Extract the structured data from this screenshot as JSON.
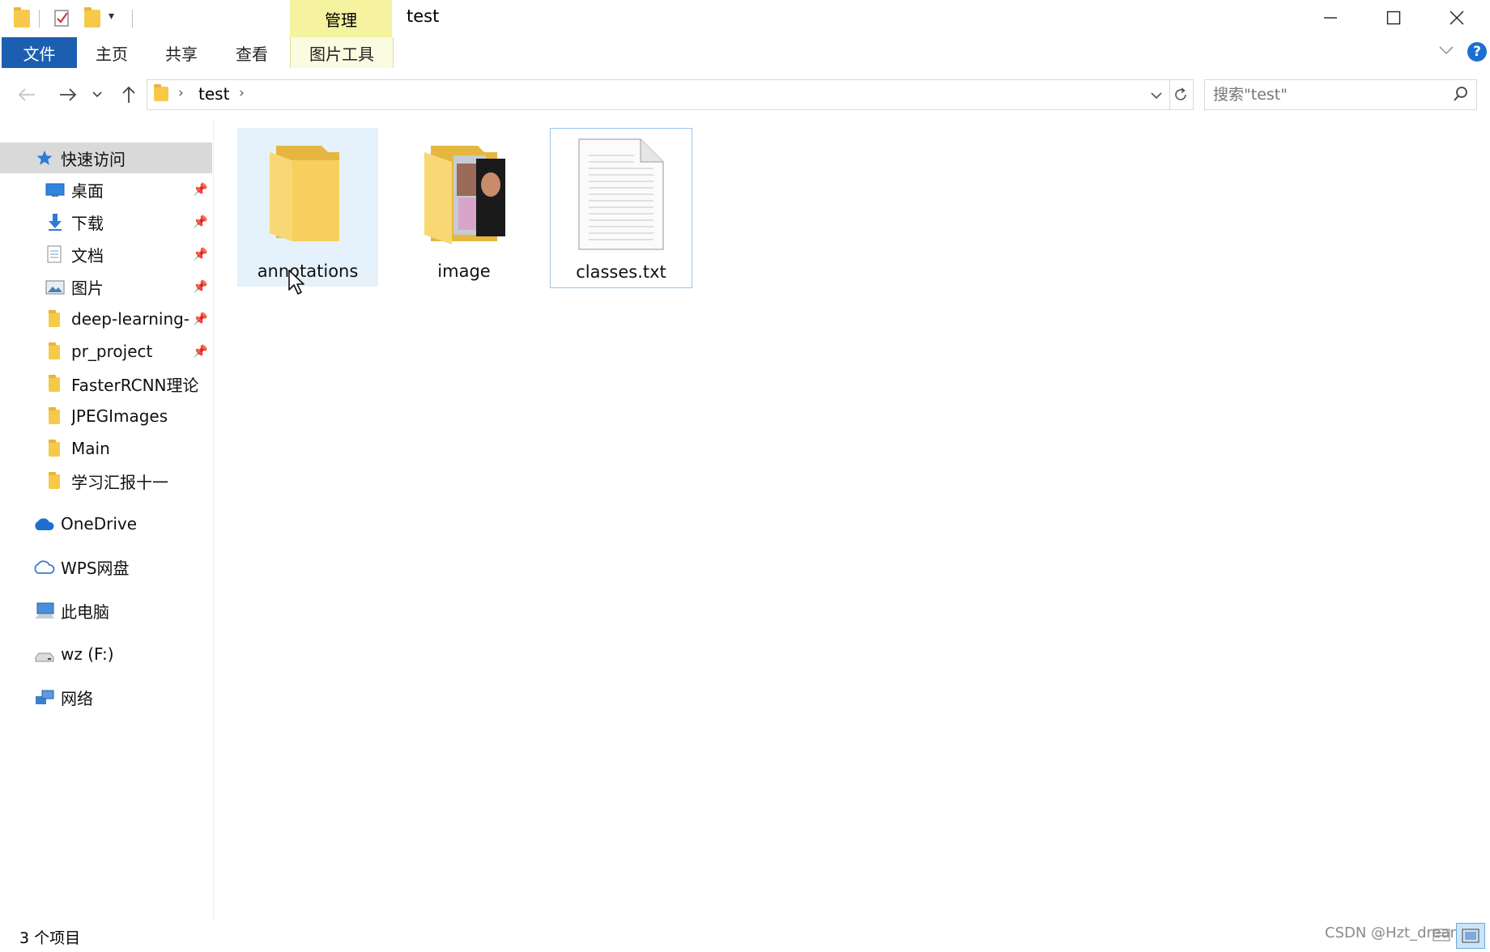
{
  "titlebar": {
    "context_tab": "管理",
    "title": "test"
  },
  "ribbon": {
    "tabs": [
      "文件",
      "主页",
      "共享",
      "查看"
    ],
    "context_tab": "图片工具"
  },
  "address": {
    "crumb": "test"
  },
  "search": {
    "placeholder": "搜索\"test\""
  },
  "sidebar": {
    "quick_access": "快速访问",
    "items": [
      {
        "label": "桌面",
        "icon": "desktop-icon",
        "pinned": true
      },
      {
        "label": "下载",
        "icon": "download-icon",
        "pinned": true
      },
      {
        "label": "文档",
        "icon": "document-icon",
        "pinned": true
      },
      {
        "label": "图片",
        "icon": "pictures-icon",
        "pinned": true
      },
      {
        "label": "deep-learning-",
        "icon": "folder-icon",
        "pinned": true
      },
      {
        "label": "pr_project",
        "icon": "folder-icon",
        "pinned": true
      },
      {
        "label": "FasterRCNN理论",
        "icon": "folder-icon",
        "pinned": false
      },
      {
        "label": "JPEGImages",
        "icon": "folder-icon",
        "pinned": false
      },
      {
        "label": "Main",
        "icon": "folder-icon",
        "pinned": false
      },
      {
        "label": "学习汇报十一",
        "icon": "folder-icon",
        "pinned": false
      }
    ],
    "onedrive": "OneDrive",
    "wps": "WPS网盘",
    "this_pc": "此电脑",
    "drive": "wz (F:)",
    "network": "网络"
  },
  "files": [
    {
      "name": "annotations",
      "type": "folder"
    },
    {
      "name": "image",
      "type": "folder-with-images"
    },
    {
      "name": "classes.txt",
      "type": "text-file"
    }
  ],
  "status": {
    "count": "3 个项目"
  },
  "watermark": "CSDN @Hzt_dreamer",
  "colors": {
    "file_tab": "#1c5fb1",
    "manage_tab": "#f5f2a0",
    "selection": "#e5f1fb",
    "folder": "#f6c94a"
  }
}
